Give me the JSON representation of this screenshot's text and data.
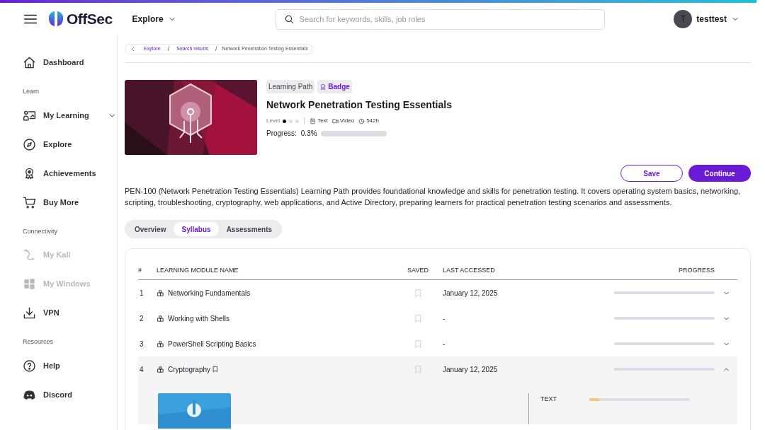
{
  "header": {
    "logo": "OffSec",
    "explore": "Explore",
    "search": {
      "placeholder": "Search for keywords, skills, job roles"
    },
    "user": {
      "initial": "T",
      "name": "testtest"
    }
  },
  "sidebar": {
    "sections": [
      {
        "items": [
          {
            "label": "Dashboard",
            "disabled": false
          }
        ]
      },
      {
        "title": "Learn",
        "items": [
          {
            "label": "My Learning",
            "disabled": false,
            "expanded": false
          },
          {
            "label": "Explore",
            "disabled": false
          },
          {
            "label": "Achievements",
            "disabled": false
          },
          {
            "label": "Buy More",
            "disabled": false
          }
        ]
      },
      {
        "title": "Connectivity",
        "items": [
          {
            "label": "My Kali",
            "disabled": true
          },
          {
            "label": "My Windows",
            "disabled": true
          },
          {
            "label": "VPN",
            "disabled": false
          }
        ]
      },
      {
        "title": "Resources",
        "items": [
          {
            "label": "Help",
            "disabled": false
          },
          {
            "label": "Discord",
            "disabled": false
          }
        ]
      }
    ]
  },
  "breadcrumb": [
    {
      "label": "Explore",
      "kind": "link"
    },
    {
      "label": "/",
      "kind": "separator"
    },
    {
      "label": "Search results",
      "kind": "link"
    },
    {
      "label": "/",
      "kind": "separator"
    },
    {
      "label": "Network Penetration Testing Essentials",
      "kind": "current"
    }
  ],
  "course": {
    "tags": [
      {
        "label": "Learning Path",
        "kind": "plain"
      },
      {
        "label": "Badge",
        "kind": "badge"
      }
    ],
    "title": "Network Penetration Testing Essentials",
    "level_label": "Level",
    "level_dots": [
      {
        "filled": true
      },
      {
        "filled": false
      },
      {
        "filled": false
      }
    ],
    "formats": [
      "Text",
      "Video",
      "542h"
    ],
    "progress_label": "Progress:",
    "progress_value": "0.3%",
    "level": 0.003
  },
  "buttons": [
    {
      "label": "Save",
      "kind": "outline"
    },
    {
      "label": "Continue",
      "kind": "primary"
    }
  ],
  "description": "PEN-100 (Network Penetration Testing Essentials) Learning Path provides foundational knowledge and skills for penetration testing. It covers operating system basics, networking, scripting, troubleshooting, cryptography, web applications, and Active Directory, preparing learners for practical penetration testing scenarios and assessments.",
  "tabs": [
    {
      "label": "Overview",
      "selected": false
    },
    {
      "label": "Syllabus",
      "selected": true
    },
    {
      "label": "Assessments",
      "selected": false
    }
  ],
  "table": {
    "columns": [
      "#",
      "LEARNING MODULE NAME",
      "SAVED",
      "LAST ACCESSED",
      "PROGRESS"
    ],
    "rows": [
      {
        "number": "1",
        "name": "Networking Fundamentals",
        "bookmarked": false,
        "saved": false,
        "last_accessed": "January 12, 2025",
        "level": 0.01,
        "expanded": false
      },
      {
        "number": "2",
        "name": "Working with Shells",
        "bookmarked": false,
        "saved": false,
        "last_accessed": "-",
        "level": 0,
        "expanded": false
      },
      {
        "number": "3",
        "name": "PowerShell Scripting Basics",
        "bookmarked": false,
        "saved": false,
        "last_accessed": "-",
        "level": 0,
        "expanded": false
      },
      {
        "number": "4",
        "name": "Cryptography",
        "bookmarked": true,
        "saved": false,
        "last_accessed": "January 12, 2025",
        "level": 0.01,
        "expanded": true,
        "details": [
          {
            "label": "TEXT",
            "level": 0.1
          }
        ]
      }
    ]
  }
}
